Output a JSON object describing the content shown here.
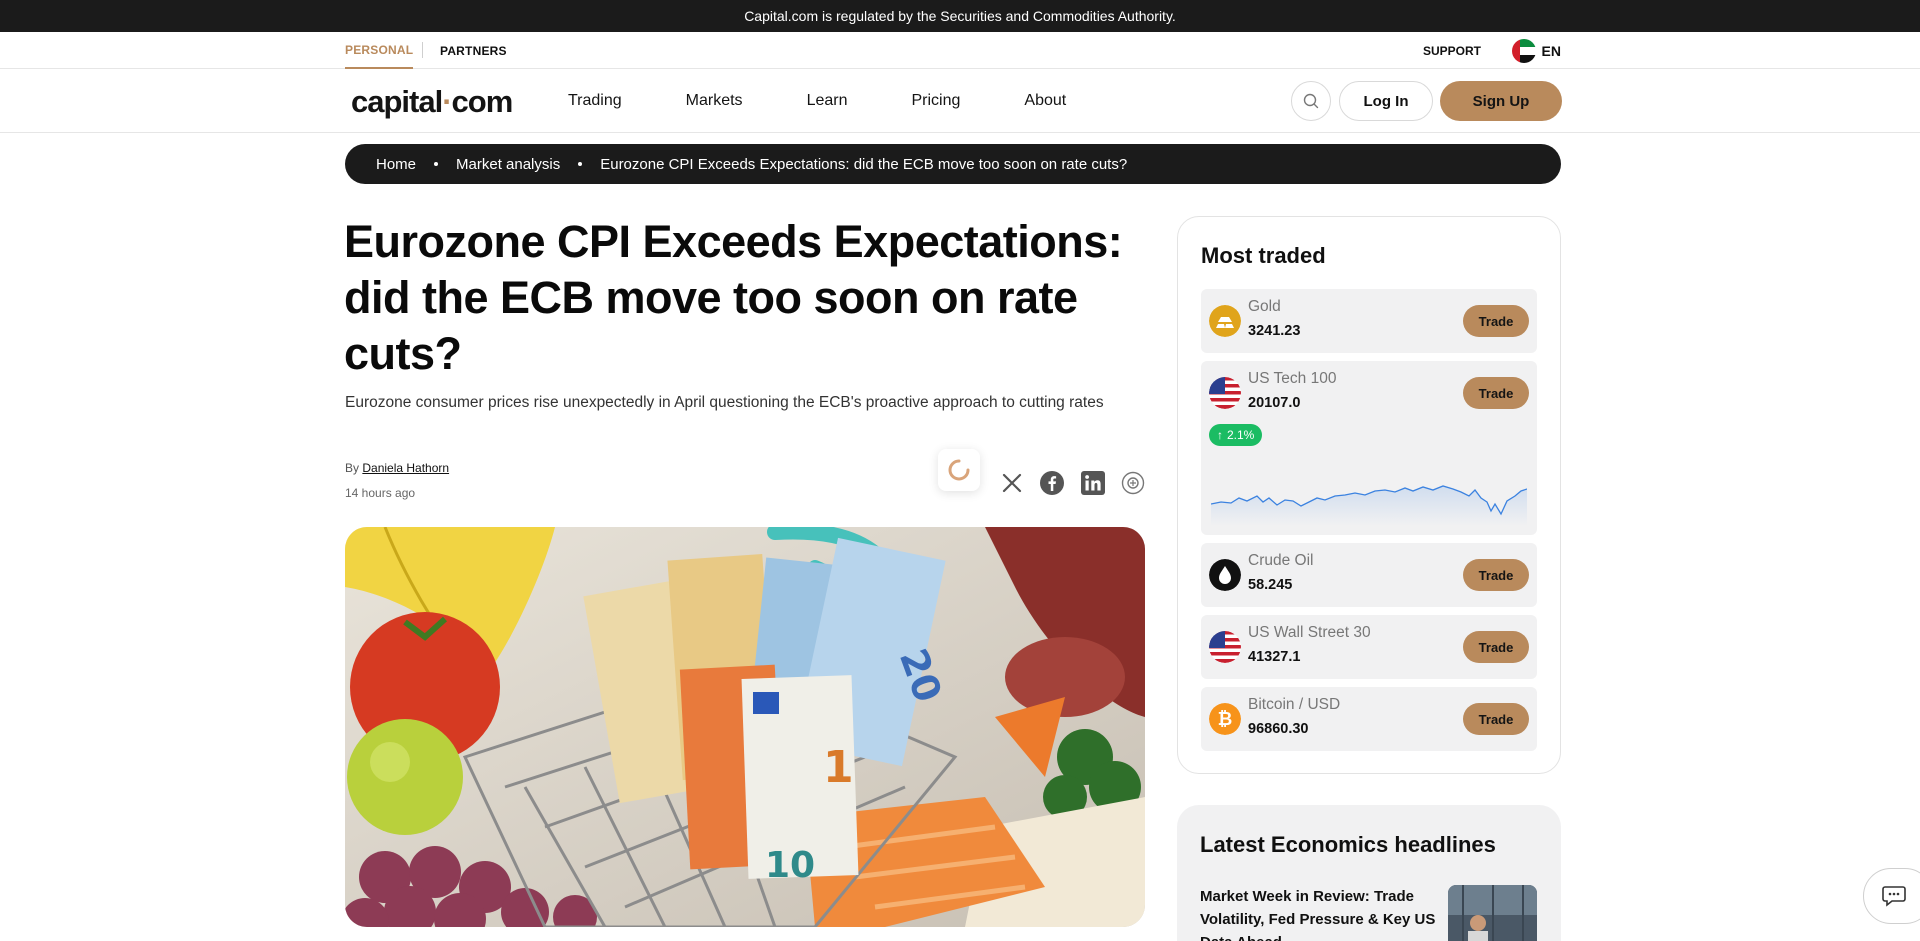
{
  "regulatory_banner": "Capital.com is regulated by the Securities and Commodities Authority.",
  "top_bar": {
    "personal": "PERSONAL",
    "partners": "PARTNERS",
    "support": "SUPPORT",
    "language": "EN"
  },
  "header": {
    "logo_pre": "capital",
    "logo_dot": "·",
    "logo_post": "com",
    "nav": [
      "Trading",
      "Markets",
      "Learn",
      "Pricing",
      "About"
    ],
    "login": "Log In",
    "signup": "Sign Up"
  },
  "breadcrumb": [
    "Home",
    "Market analysis",
    "Eurozone CPI Exceeds Expectations: did the ECB move too soon on rate cuts?"
  ],
  "article": {
    "title": "Eurozone CPI Exceeds Expectations: did the ECB move too soon on rate cuts?",
    "subtitle": "Eurozone consumer prices rise unexpectedly in April questioning the ECB's proactive approach to cutting rates",
    "by": "By",
    "author": "Daniela Hathorn",
    "time_ago": "14 hours ago"
  },
  "most_traded": {
    "title": "Most traded",
    "trade_label": "Trade",
    "items": [
      {
        "name": "Gold",
        "price": "3241.23",
        "icon": "gold-bars-icon"
      },
      {
        "name": "US Tech 100",
        "price": "20107.0",
        "icon": "us-flag-icon",
        "change": "2.1%"
      },
      {
        "name": "Crude Oil",
        "price": "58.245",
        "icon": "oil-drop-icon"
      },
      {
        "name": "US Wall Street 30",
        "price": "41327.1",
        "icon": "us-flag-icon"
      },
      {
        "name": "Bitcoin / USD",
        "price": "96860.30",
        "icon": "bitcoin-icon"
      }
    ]
  },
  "latest": {
    "title": "Latest Economics headlines",
    "item_title": "Market Week in Review: Trade Volatility, Fed Pressure & Key US Data Ahead"
  },
  "colors": {
    "accent": "#b98a5c",
    "dark": "#1b1b1b",
    "positive": "#1bbc63",
    "chart_line": "#3b82e0"
  }
}
